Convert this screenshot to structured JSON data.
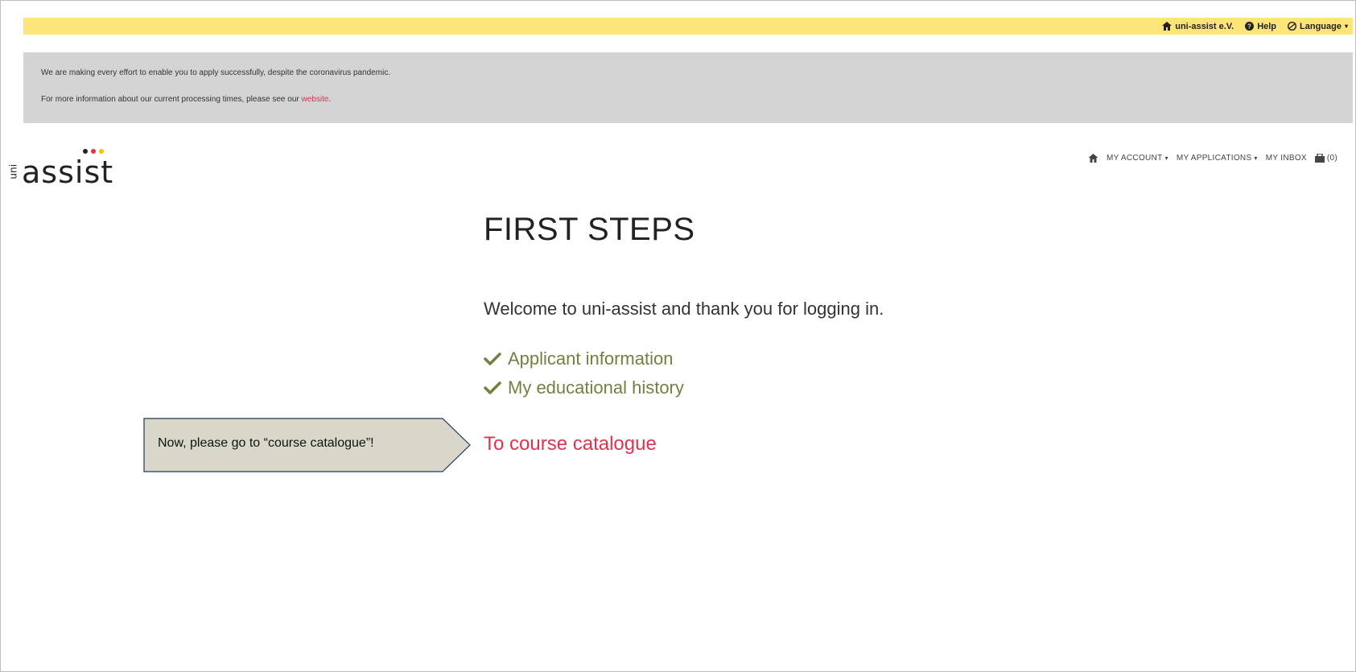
{
  "topbar": {
    "home_label": "uni-assist e.V.",
    "help_label": "Help",
    "language_label": "Language"
  },
  "notice": {
    "line1": "We are making every effort to enable you to apply successfully, despite the coronavirus pandemic.",
    "line2_prefix": "For more information about our current processing times, please see our ",
    "line2_link": "website",
    "line2_suffix": "."
  },
  "logo": {
    "prefix": "uni",
    "word": "assist",
    "dot_colors": [
      "#222222",
      "#e0334f",
      "#f5c400"
    ]
  },
  "mainnav": {
    "account": "MY ACCOUNT",
    "applications": "MY APPLICATIONS",
    "inbox": "MY INBOX",
    "cart_count": "(0)"
  },
  "content": {
    "title": "FIRST STEPS",
    "welcome": "Welcome to uni-assist and thank you for logging in.",
    "steps": [
      {
        "label": "Applicant information",
        "done": true
      },
      {
        "label": "My educational history",
        "done": true
      }
    ],
    "course_link": "To course catalogue"
  },
  "callout": {
    "text": "Now, please go to “course catalogue”!"
  },
  "colors": {
    "topbar": "#fde57a",
    "notice_bg": "#d4d4d4",
    "accent_red": "#e0334f",
    "check_green": "#757f3f",
    "callout_bg": "#d9d7c9",
    "callout_border": "#1f3a5a"
  }
}
